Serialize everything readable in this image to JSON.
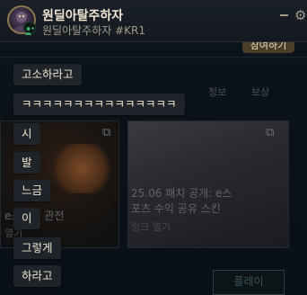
{
  "header": {
    "contact_name": "원딜아탈주하자",
    "contact_tag": "원딜아탈주하자 #KR1",
    "avatar_icon": "profile-avatar",
    "minimize_icon": "minimize-icon",
    "settings_icon": "gear-icon"
  },
  "background": {
    "top_button_label": "참여하기",
    "tabs": [
      "정보",
      "보상"
    ],
    "card_left": {
      "caption": "e스포츠 관전",
      "sub": "열기"
    },
    "card_right": {
      "caption_line1": "25.06 패치 공개: e스",
      "caption_line2": "포츠 수익 공유 스킨",
      "sub": "링크 열기"
    },
    "play_button_label": "플레이"
  },
  "messages": [
    "고소하라고",
    "ㅋㅋㅋㅋㅋㅋㅋㅋㅋㅋㅋㅋㅋㅋㅋ",
    "시",
    "발",
    "느금",
    "이",
    "그렇게",
    "하라고"
  ]
}
